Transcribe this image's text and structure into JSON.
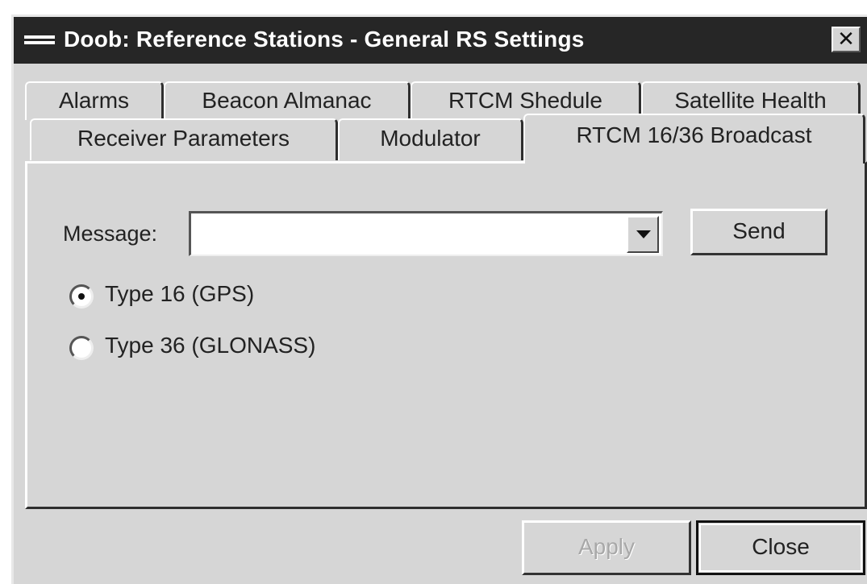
{
  "window": {
    "title": "Doob: Reference Stations - General RS Settings",
    "close_glyph": "✕"
  },
  "tabs": {
    "row1": [
      "Alarms",
      "Beacon Almanac",
      "RTCM Shedule",
      "Satellite Health"
    ],
    "row2": [
      "Receiver Parameters",
      "Modulator",
      "RTCM 16/36 Broadcast"
    ],
    "active": "RTCM 16/36 Broadcast"
  },
  "panel": {
    "message_label": "Message:",
    "message_value": "",
    "send_label": "Send",
    "radios": [
      {
        "label": "Type 16 (GPS)",
        "checked": true
      },
      {
        "label": "Type 36 (GLONASS)",
        "checked": false
      }
    ]
  },
  "footer": {
    "apply_label": "Apply",
    "apply_enabled": false,
    "close_label": "Close"
  },
  "icons": {
    "window_icon": "window-menu-icon",
    "dropdown": "chevron-down-icon",
    "close": "close-icon"
  }
}
